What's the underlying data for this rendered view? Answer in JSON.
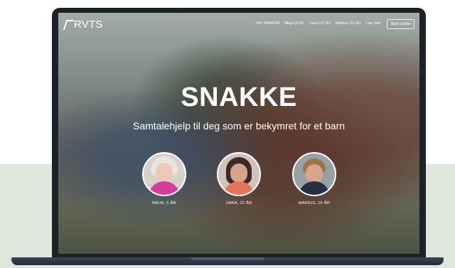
{
  "brand": {
    "logo_text": "RVTS"
  },
  "nav": {
    "links": [
      "Om SNAKKE",
      "Maja (5 år)",
      "Zara (12 år)",
      "Marius (15 år)",
      "Lær mer"
    ],
    "start_button": "Start spillet"
  },
  "hero": {
    "title": "SNAKKE",
    "subtitle": "Samtalehjelp til deg som er bekymret for et barn"
  },
  "characters": [
    {
      "name": "MAJA, 5 ÅR"
    },
    {
      "name": "ZARA, 12 ÅR"
    },
    {
      "name": "MARIUS, 15 ÅR"
    }
  ]
}
